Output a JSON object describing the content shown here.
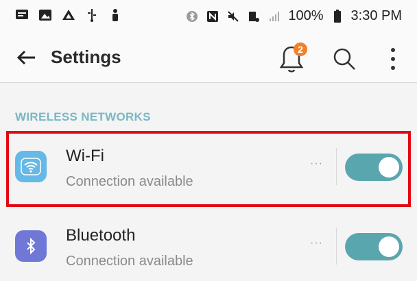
{
  "status_bar": {
    "left_icons": [
      "message-icon",
      "gallery-icon",
      "drive-icon",
      "usb-icon",
      "person-icon"
    ],
    "right_icons": [
      "bluetooth-icon",
      "nfc-icon",
      "mute-icon",
      "wifi-icon",
      "signal-icon",
      "battery-icon"
    ],
    "battery": "100%",
    "time": "3:30 PM"
  },
  "app_bar": {
    "title": "Settings",
    "notification_count": "2",
    "icons": [
      "back-arrow-icon",
      "bell-icon",
      "search-icon",
      "more-vert-icon"
    ]
  },
  "section": {
    "header": "WIRELESS NETWORKS"
  },
  "rows": [
    {
      "title": "Wi-Fi",
      "subtitle": "Connection available",
      "more": "···",
      "toggle_on": true,
      "icon": "wifi-icon",
      "icon_color": "#66b8e6"
    },
    {
      "title": "Bluetooth",
      "subtitle": "Connection available",
      "more": "···",
      "toggle_on": true,
      "icon": "bluetooth-icon",
      "icon_color": "#6f78d6"
    }
  ],
  "colors": {
    "accent": "#5aa6ae",
    "section_header": "#79b7c3",
    "highlight": "#e30613",
    "badge": "#f0812b"
  }
}
